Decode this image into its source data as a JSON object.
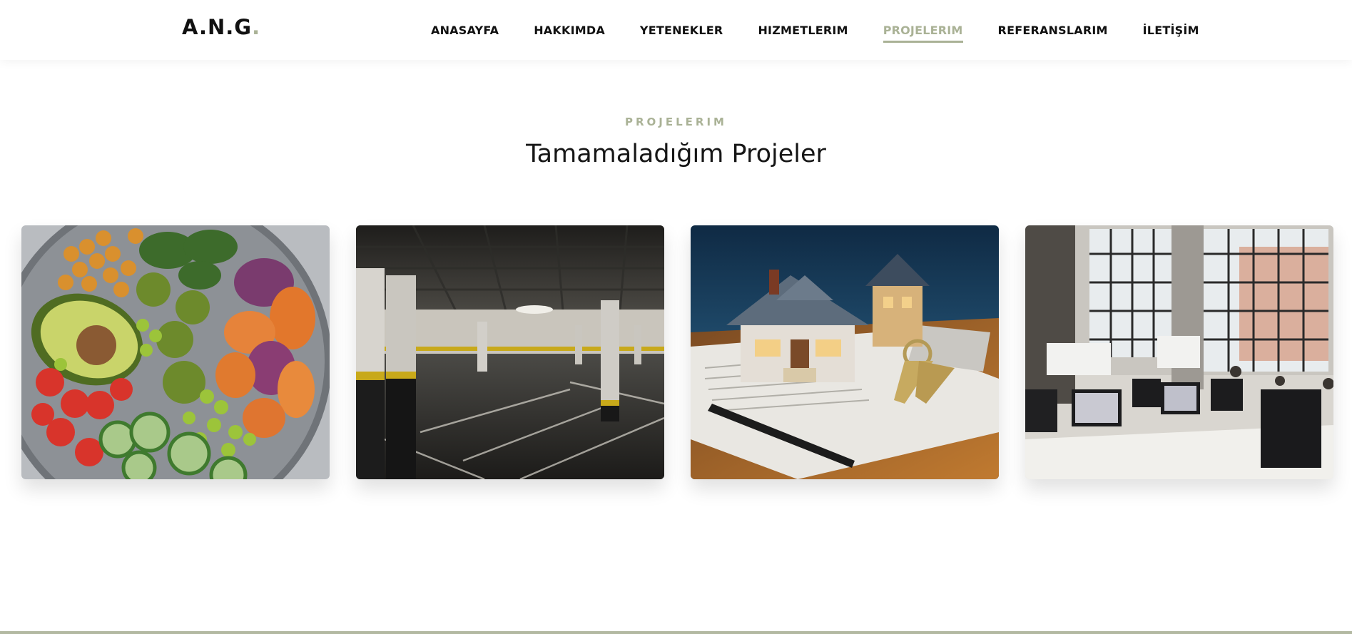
{
  "brand": {
    "name": "A.N.G",
    "dot": "."
  },
  "nav": {
    "items": [
      {
        "label": "ANASAYFA"
      },
      {
        "label": "HAKKIMDA"
      },
      {
        "label": "YETENEKLER"
      },
      {
        "label": "HIZMETLERIM"
      },
      {
        "label": "PROJELERIM",
        "active": true
      },
      {
        "label": "REFERANSLARIM"
      },
      {
        "label": "İLETİŞİM"
      }
    ]
  },
  "section": {
    "eyebrow": "PROJELERIM",
    "title": "Tamamaladığım Projeler"
  },
  "projects": [
    {
      "image": "food-bowl-image"
    },
    {
      "image": "parking-garage-image"
    },
    {
      "image": "house-model-keys-image"
    },
    {
      "image": "office-workspace-image"
    }
  ],
  "colors": {
    "accent": "#aab296",
    "text": "#111111",
    "footer_line": "#b3b9a2"
  }
}
